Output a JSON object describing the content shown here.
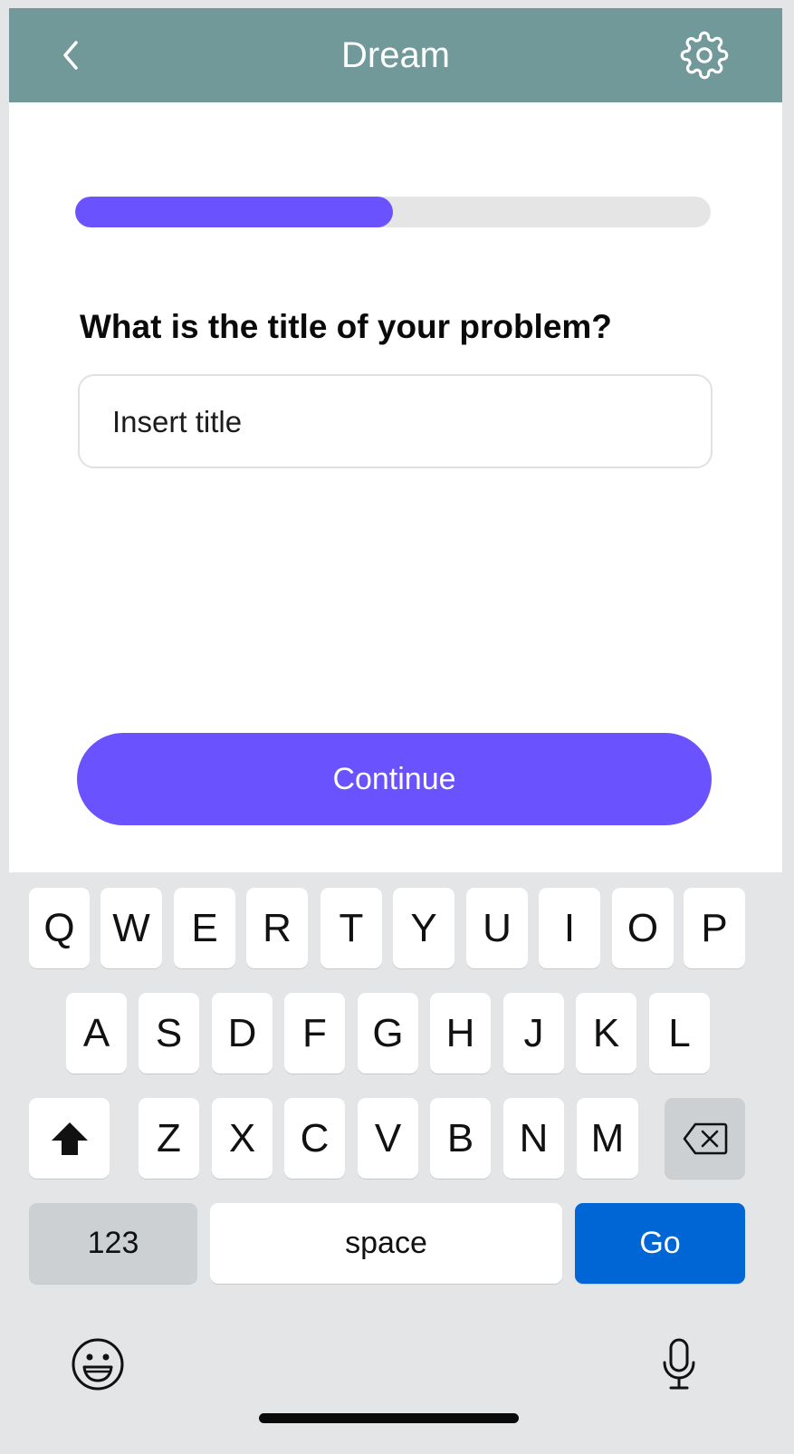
{
  "header": {
    "title": "Dream",
    "back_icon": "chevron-left-icon",
    "settings_icon": "gear-icon",
    "background_color": "#71999a"
  },
  "progress": {
    "fraction": 0.5,
    "color": "#6b52ff",
    "track_color": "#e5e5e5"
  },
  "question": "What is the title of your problem?",
  "title_input": {
    "placeholder": "Insert title",
    "value": ""
  },
  "continue_button": {
    "label": "Continue",
    "color": "#6b52ff"
  },
  "keyboard": {
    "row1": [
      "Q",
      "W",
      "E",
      "R",
      "T",
      "Y",
      "U",
      "I",
      "O",
      "P"
    ],
    "row2": [
      "A",
      "S",
      "D",
      "F",
      "G",
      "H",
      "J",
      "K",
      "L"
    ],
    "row3": [
      "Z",
      "X",
      "C",
      "V",
      "B",
      "N",
      "M"
    ],
    "numbers_label": "123",
    "space_label": "space",
    "go_label": "Go",
    "go_color": "#0066d5",
    "icons": [
      "shift-icon",
      "backspace-icon",
      "emoji-icon",
      "microphone-icon"
    ]
  }
}
